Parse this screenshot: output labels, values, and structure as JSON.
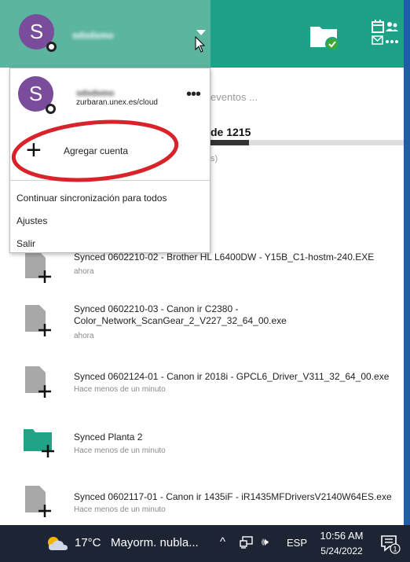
{
  "header": {
    "account_initial": "S",
    "account_name": "sdsdsmo"
  },
  "menu": {
    "account_initial": "S",
    "account_name": "sdsdsmo",
    "account_server": "zurbaran.unex.es/cloud",
    "more_label": "•••",
    "add_account_label": "Agregar cuenta",
    "resume_all_label": "Continuar sincronización para todos",
    "settings_label": "Ajustes",
    "quit_label": "Salir"
  },
  "activity_header": {
    "search_placeholder": "eventos ...",
    "sync_count": "de 1215",
    "sync_progress": 0.2,
    "sync_hint": "s)"
  },
  "activity": [
    {
      "title": "Synced 0602210-02 - Brother HL L6400DW - Y15B_C1-hostm-240.EXE",
      "time": "ahora",
      "icon": "file-add-icon"
    },
    {
      "title": "Synced 0602210-03 - Canon ir C2380 - Color_Network_ScanGear_2_V227_32_64_00.exe",
      "time": "ahora",
      "icon": "file-add-icon"
    },
    {
      "title": "Synced 0602124-01 - Canon ir 2018i - GPCL6_Driver_V311_32_64_00.exe",
      "time": "Hace menos de un minuto",
      "icon": "file-add-icon"
    },
    {
      "title": "Synced Planta 2",
      "time": "Hace menos de un minuto",
      "icon": "folder-add-icon"
    },
    {
      "title": "Synced 0602117-01 - Canon ir 1435iF - iR1435MFDriversV2140W64ES.exe",
      "time": "Hace menos de un minuto",
      "icon": "file-add-icon"
    }
  ],
  "taskbar": {
    "temperature": "17°C",
    "weather": "Mayorm. nubla...",
    "tray_chevron": "^",
    "language": "ESP",
    "time": "10:56 AM",
    "date": "5/24/2022",
    "notification_count": "1"
  },
  "colors": {
    "header": "#1fa187",
    "header_left": "#5cb59f",
    "avatar": "#7a4c9c",
    "annotation_ellipse": "#d9232a",
    "taskbar": "#1d2433"
  }
}
